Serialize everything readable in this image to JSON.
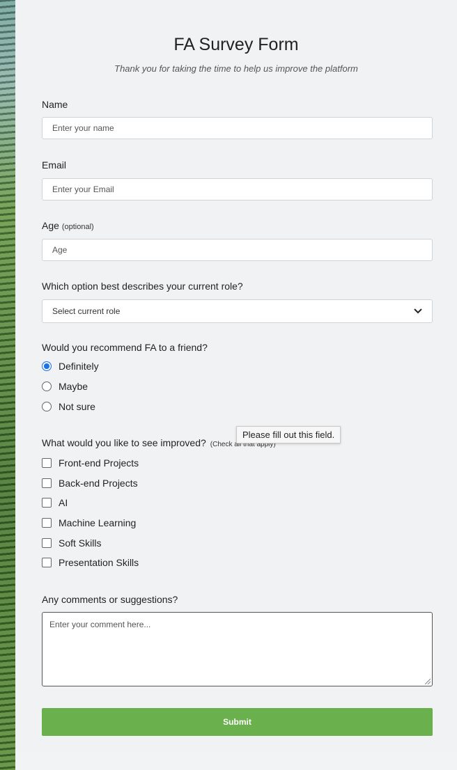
{
  "form": {
    "title": "FA Survey Form",
    "subtitle": "Thank you for taking the time to help us improve the platform",
    "name": {
      "label": "Name",
      "placeholder": "Enter your name"
    },
    "email": {
      "label": "Email",
      "placeholder": "Enter your Email"
    },
    "age": {
      "label": "Age",
      "hint": "(optional)",
      "placeholder": "Age"
    },
    "role": {
      "label": "Which option best describes your current role?",
      "selected": "Select current role"
    },
    "recommend": {
      "label": "Would you recommend FA to a friend?",
      "options": [
        "Definitely",
        "Maybe",
        "Not sure"
      ],
      "selected_index": 0
    },
    "improve": {
      "label": "What would you like to see improved?",
      "hint": "(Check all that apply)",
      "options": [
        "Front-end Projects",
        "Back-end Projects",
        "AI",
        "Machine Learning",
        "Soft Skills",
        "Presentation Skills"
      ]
    },
    "comments": {
      "label": "Any comments or suggestions?",
      "placeholder": "Enter your comment here..."
    },
    "submit_label": "Submit",
    "tooltip": "Please fill out this field."
  },
  "colors": {
    "accent": "#1a73e8",
    "submit": "#6ab04c",
    "background": "#f1f2f4"
  }
}
